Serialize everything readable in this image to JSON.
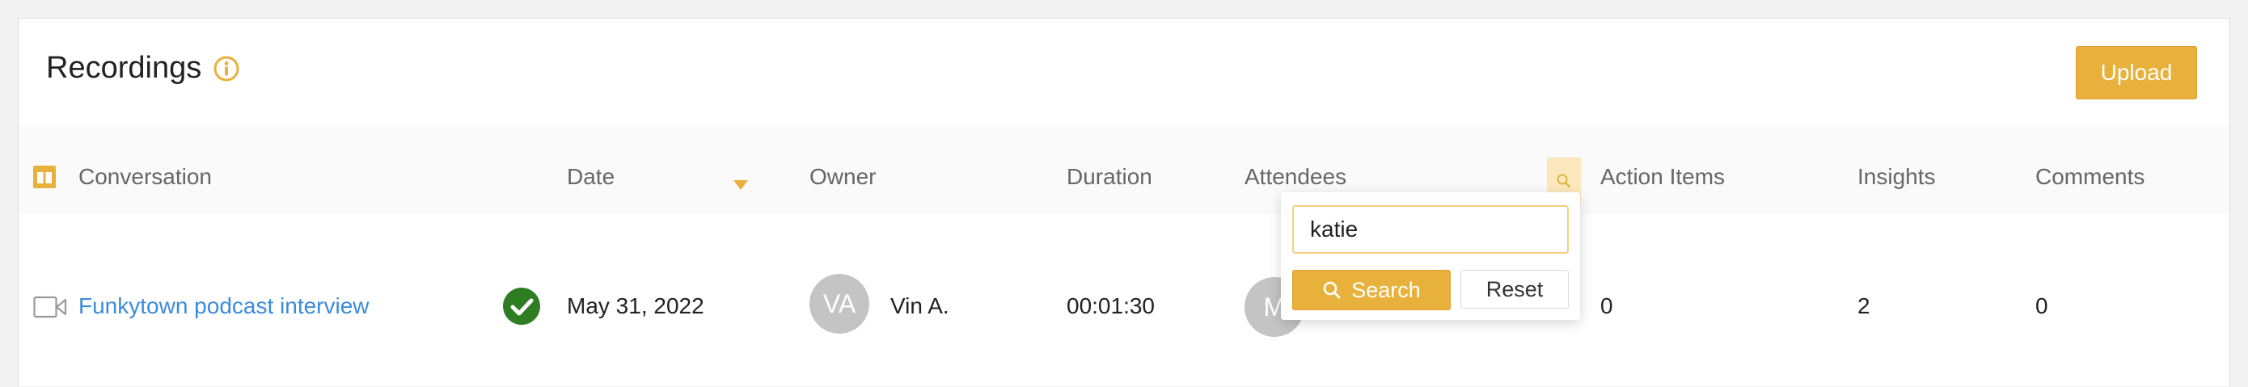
{
  "header": {
    "title": "Recordings",
    "info_icon": "info-circle-icon",
    "upload_label": "Upload"
  },
  "columns": {
    "conversation": "Conversation",
    "date": "Date",
    "owner": "Owner",
    "duration": "Duration",
    "attendees": "Attendees",
    "action_items": "Action Items",
    "insights": "Insights",
    "comments": "Comments"
  },
  "row": {
    "conversation": "Funkytown podcast interview",
    "status_icon": "check-circle-icon",
    "date": "May 31, 2022",
    "owner_initials": "VA",
    "owner_name": "Vin A.",
    "duration": "00:01:30",
    "attendee_initial": "M",
    "action_items": "0",
    "insights": "2",
    "comments": "0"
  },
  "attendee_filter": {
    "value": "katie",
    "search_label": "Search",
    "reset_label": "Reset"
  },
  "colors": {
    "accent": "#e8b13b",
    "link": "#3b8bdc",
    "success": "#2e7d23"
  }
}
